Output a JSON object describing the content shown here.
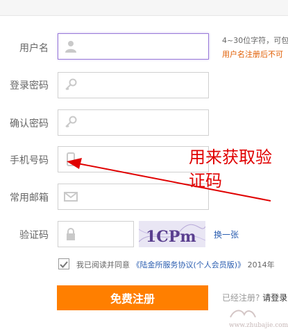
{
  "form": {
    "username": {
      "label": "用户名",
      "value": "",
      "hint1": "4~30位字符，可包",
      "hint2": "用户名注册后不可"
    },
    "password": {
      "label": "登录密码",
      "value": ""
    },
    "confirm_password": {
      "label": "确认密码",
      "value": ""
    },
    "phone": {
      "label": "手机号码",
      "value": ""
    },
    "email": {
      "label": "常用邮箱",
      "value": ""
    },
    "captcha": {
      "label": "验证码",
      "value": "",
      "image_text": "1CPm",
      "refresh_label": "换一张"
    }
  },
  "agreement": {
    "checked": true,
    "prefix": "我已阅读并同意",
    "link_label": "《陆金所服务协议(个人会员版)》",
    "suffix": "2014年"
  },
  "submit_label": "免费注册",
  "login": {
    "prompt": "已经注册?",
    "link_label": "请登录"
  },
  "annotation": {
    "text": "用来获取验证码",
    "color": "#e00000"
  },
  "watermark": {
    "text": "www.zhubajie.com"
  },
  "colors": {
    "accent": "#ff7f00",
    "link": "#2a5db0",
    "warning": "#e05c00",
    "focus": "#9a7bd8"
  },
  "icons": [
    "user-icon",
    "key-icon",
    "phone-icon",
    "mail-icon",
    "lock-icon",
    "check-icon"
  ]
}
